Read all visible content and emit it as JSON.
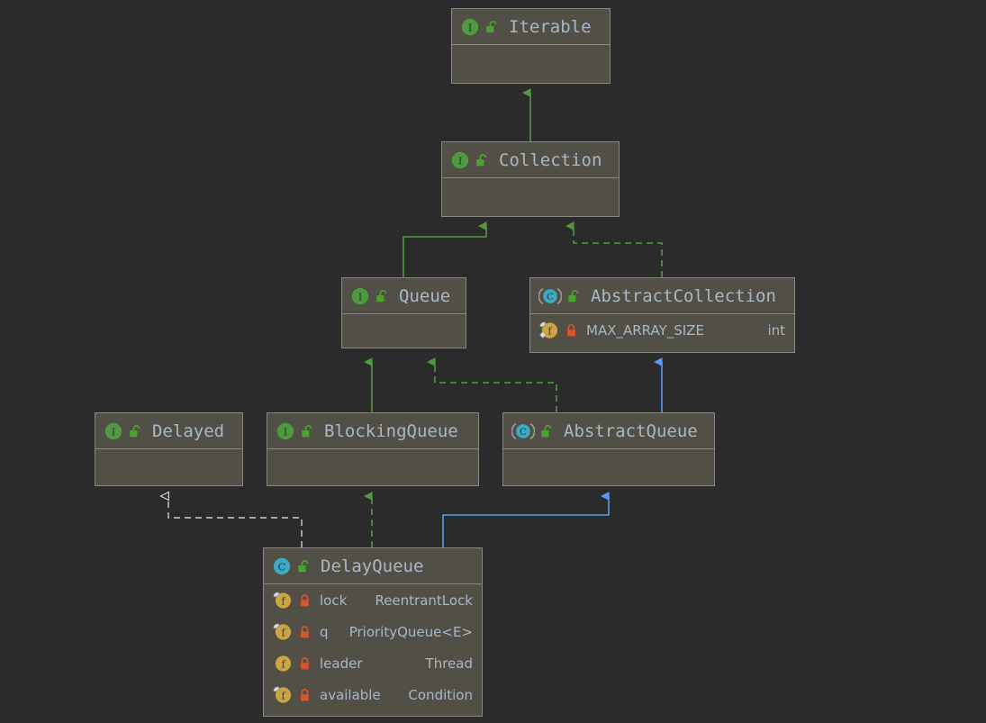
{
  "diagram": {
    "type": "uml-class-diagram",
    "title": "DelayQueue class hierarchy",
    "background_color": "#2b2b2b",
    "node_fill_color": "#514f46",
    "node_border_color": "#8a8880",
    "text_color": "#a9b7c6",
    "interface_icon_color": "#4f9a41",
    "class_icon_color": "#3babc4",
    "field_icon_color": "#c9a545",
    "public_lock_color": "#4ba32f",
    "private_lock_color": "#d9542b",
    "extends_edge_color": "#4f9a41",
    "class_extends_edge_color": "#3f92e8",
    "realize_edge_color": "#cfcfcf"
  },
  "nodes": [
    {
      "id": "iterable",
      "name": "Iterable",
      "kind": "interface",
      "kind_icon": "interface-icon",
      "visibility": "public",
      "visibility_icon": "unlock-icon",
      "members": []
    },
    {
      "id": "collection",
      "name": "Collection",
      "kind": "interface",
      "kind_icon": "interface-icon",
      "visibility": "public",
      "visibility_icon": "unlock-icon",
      "members": []
    },
    {
      "id": "queue",
      "name": "Queue",
      "kind": "interface",
      "kind_icon": "interface-icon",
      "visibility": "public",
      "visibility_icon": "unlock-icon",
      "members": []
    },
    {
      "id": "abstractcollection",
      "name": "AbstractCollection",
      "kind": "abstract-class",
      "kind_icon": "abstract-class-icon",
      "visibility": "public",
      "visibility_icon": "unlock-icon",
      "members": [
        {
          "name": "MAX_ARRAY_SIZE",
          "type": "int",
          "member_icon": "field-icon",
          "visibility": "private",
          "visibility_icon": "lock-icon",
          "final": true,
          "static": true
        }
      ]
    },
    {
      "id": "delayed",
      "name": "Delayed",
      "kind": "interface",
      "kind_icon": "interface-icon",
      "visibility": "public",
      "visibility_icon": "unlock-icon",
      "members": []
    },
    {
      "id": "blockingqueue",
      "name": "BlockingQueue",
      "kind": "interface",
      "kind_icon": "interface-icon",
      "visibility": "public",
      "visibility_icon": "unlock-icon",
      "members": []
    },
    {
      "id": "abstractqueue",
      "name": "AbstractQueue",
      "kind": "abstract-class",
      "kind_icon": "abstract-class-icon",
      "visibility": "public",
      "visibility_icon": "unlock-icon",
      "members": []
    },
    {
      "id": "delayqueue",
      "name": "DelayQueue",
      "kind": "class",
      "kind_icon": "class-icon",
      "visibility": "public",
      "visibility_icon": "unlock-icon",
      "members": [
        {
          "name": "lock",
          "type": "ReentrantLock",
          "member_icon": "field-icon",
          "visibility": "private",
          "visibility_icon": "lock-icon",
          "final": true,
          "static": false
        },
        {
          "name": "q",
          "type": "PriorityQueue<E>",
          "member_icon": "field-icon",
          "visibility": "private",
          "visibility_icon": "lock-icon",
          "final": true,
          "static": false
        },
        {
          "name": "leader",
          "type": "Thread",
          "member_icon": "field-icon",
          "visibility": "private",
          "visibility_icon": "lock-icon",
          "final": false,
          "static": false
        },
        {
          "name": "available",
          "type": "Condition",
          "member_icon": "field-icon",
          "visibility": "private",
          "visibility_icon": "lock-icon",
          "final": true,
          "static": false
        }
      ]
    }
  ],
  "edges": [
    {
      "from": "collection",
      "to": "iterable",
      "style": "solid",
      "color": "#4f9a41",
      "relation": "extends"
    },
    {
      "from": "queue",
      "to": "collection",
      "style": "solid",
      "color": "#4f9a41",
      "relation": "extends"
    },
    {
      "from": "abstractcollection",
      "to": "collection",
      "style": "dashed",
      "color": "#4f9a41",
      "relation": "implements"
    },
    {
      "from": "blockingqueue",
      "to": "queue",
      "style": "solid",
      "color": "#4f9a41",
      "relation": "extends"
    },
    {
      "from": "abstractqueue",
      "to": "queue",
      "style": "dashed",
      "color": "#4f9a41",
      "relation": "implements"
    },
    {
      "from": "abstractqueue",
      "to": "abstractcollection",
      "style": "solid",
      "color": "#3f92e8",
      "relation": "extends"
    },
    {
      "from": "delayqueue",
      "to": "delayed",
      "style": "dashed",
      "color": "#cfcfcf",
      "relation": "implements-open"
    },
    {
      "from": "delayqueue",
      "to": "blockingqueue",
      "style": "dashed",
      "color": "#4f9a41",
      "relation": "implements"
    },
    {
      "from": "delayqueue",
      "to": "abstractqueue",
      "style": "solid",
      "color": "#3f92e8",
      "relation": "extends"
    }
  ]
}
